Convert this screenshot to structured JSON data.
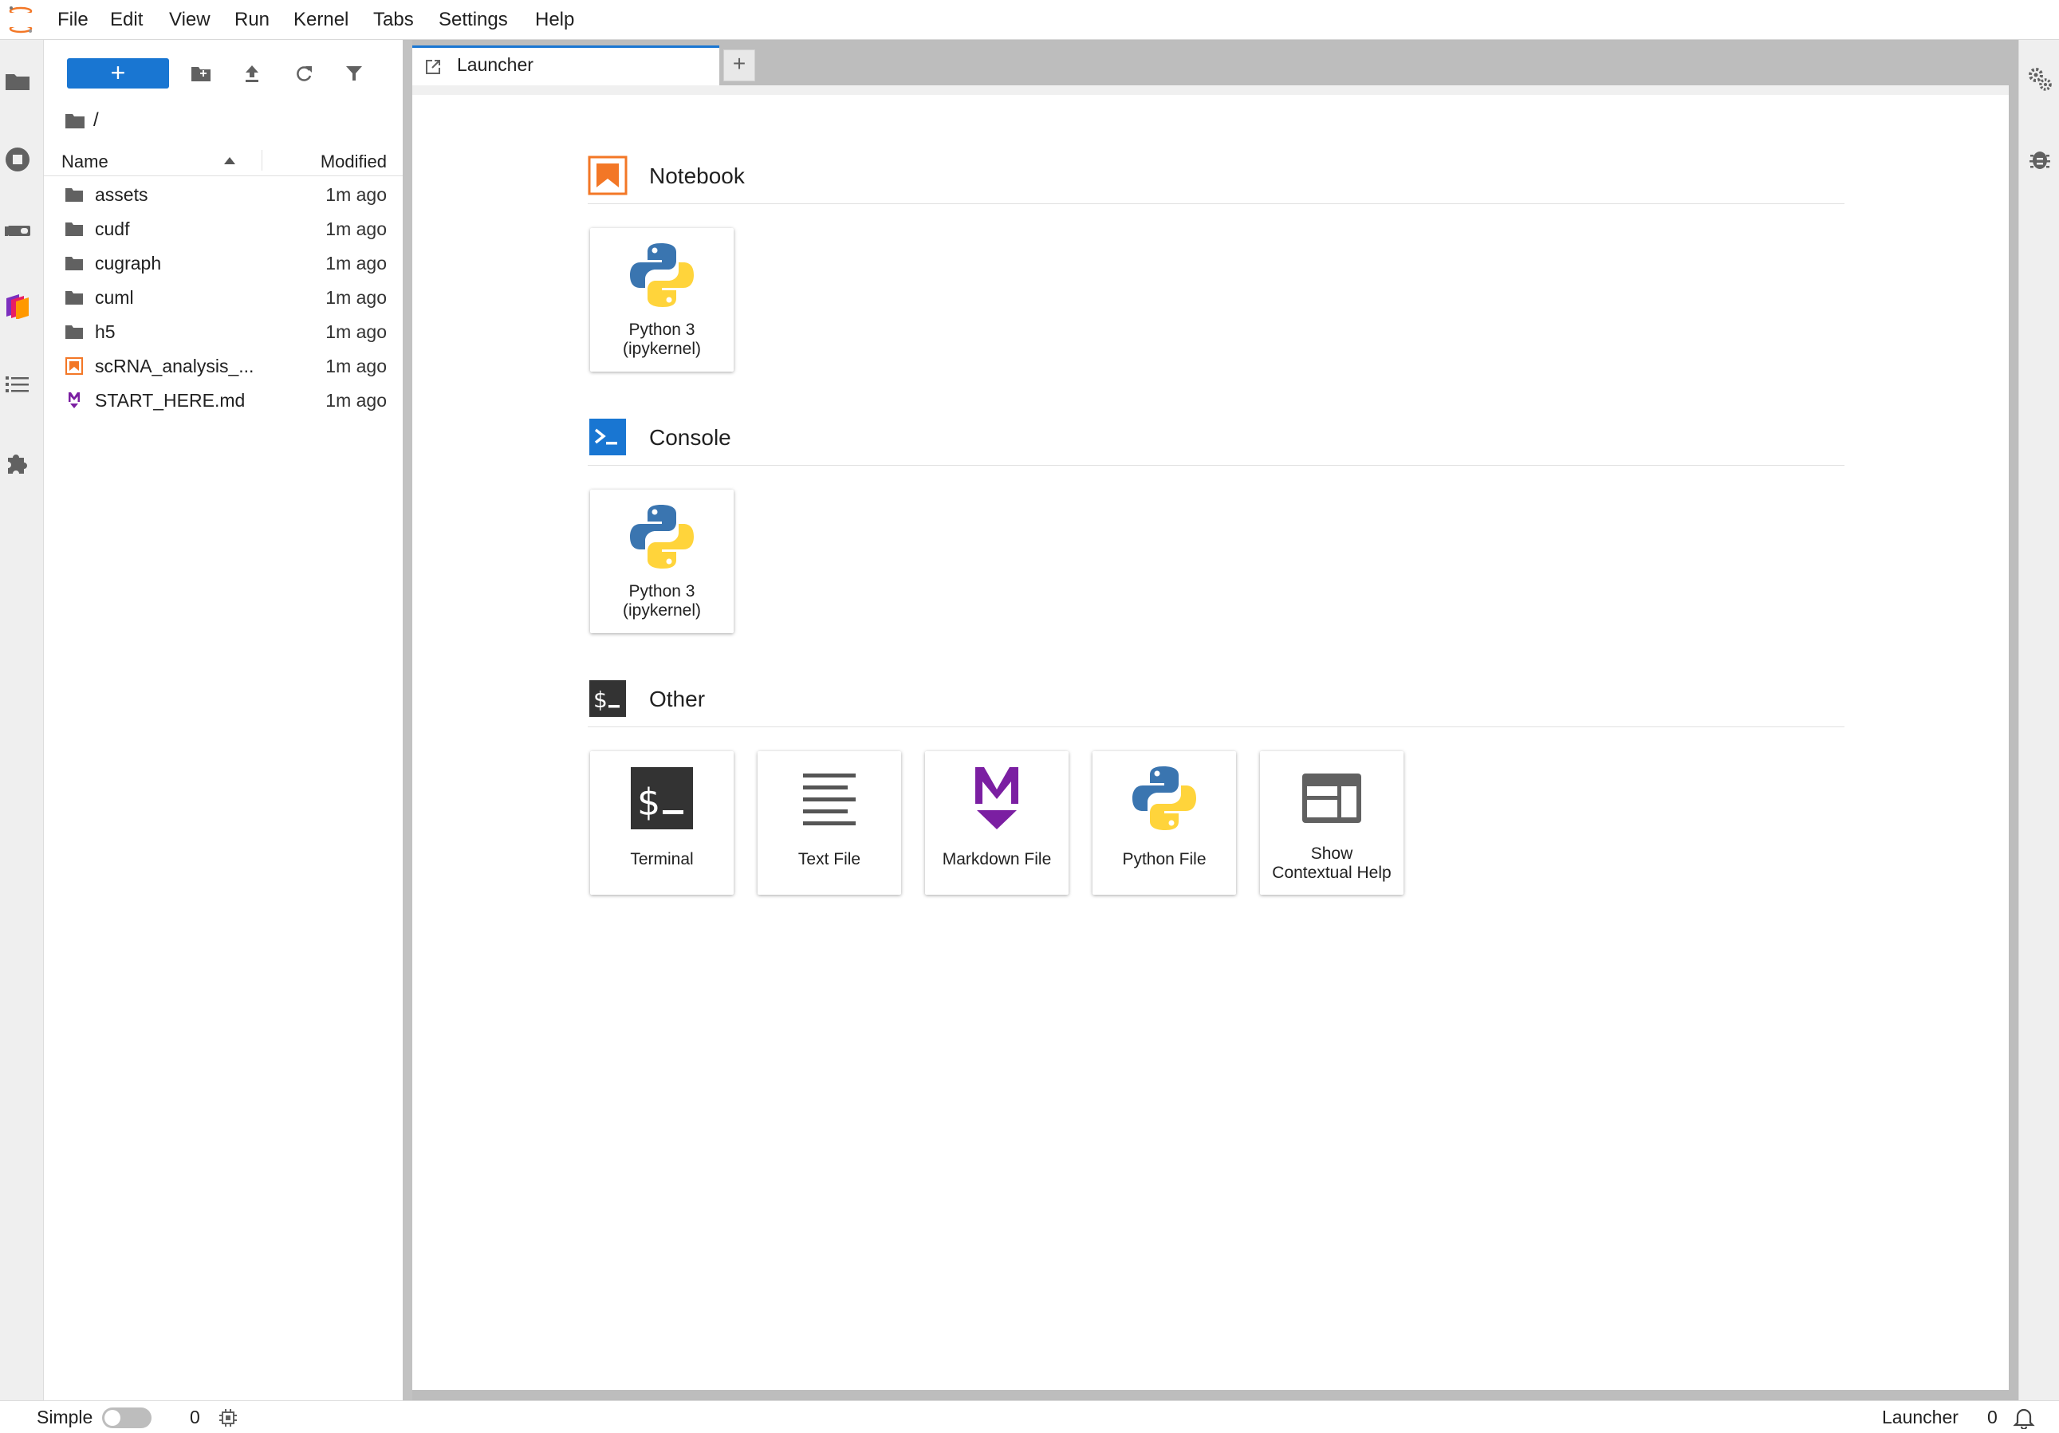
{
  "menubar": {
    "items": [
      "File",
      "Edit",
      "View",
      "Run",
      "Kernel",
      "Tabs",
      "Settings",
      "Help"
    ]
  },
  "activitybar": {
    "icons": [
      "folder-icon",
      "running-icon",
      "gpu-dashboard-icon",
      "extension-stack-icon",
      "table-of-contents-icon",
      "puzzle-icon"
    ]
  },
  "filebrowser": {
    "new_button": "+",
    "breadcrumb": "/",
    "columns": {
      "name": "Name",
      "modified": "Modified"
    },
    "rows": [
      {
        "name": "assets",
        "modified": "1m ago",
        "type": "folder"
      },
      {
        "name": "cudf",
        "modified": "1m ago",
        "type": "folder"
      },
      {
        "name": "cugraph",
        "modified": "1m ago",
        "type": "folder"
      },
      {
        "name": "cuml",
        "modified": "1m ago",
        "type": "folder"
      },
      {
        "name": "h5",
        "modified": "1m ago",
        "type": "folder"
      },
      {
        "name": "scRNA_analysis_...",
        "modified": "1m ago",
        "type": "notebook"
      },
      {
        "name": "START_HERE.md",
        "modified": "1m ago",
        "type": "markdown"
      }
    ]
  },
  "tabs": {
    "active": "Launcher",
    "add_label": "+"
  },
  "launcher": {
    "sections": [
      {
        "title": "Notebook",
        "cards": [
          {
            "label1": "Python 3",
            "label2": "(ipykernel)"
          }
        ]
      },
      {
        "title": "Console",
        "cards": [
          {
            "label1": "Python 3",
            "label2": "(ipykernel)"
          }
        ]
      },
      {
        "title": "Other",
        "cards": [
          {
            "label1": "Terminal",
            "label2": ""
          },
          {
            "label1": "Text File",
            "label2": ""
          },
          {
            "label1": "Markdown File",
            "label2": ""
          },
          {
            "label1": "Python File",
            "label2": ""
          },
          {
            "label1": "Show",
            "label2": "Contextual Help"
          }
        ]
      }
    ]
  },
  "statusbar": {
    "mode_label": "Simple",
    "kernels_count": "0",
    "active_label": "Launcher",
    "notifications_count": "0"
  },
  "colors": {
    "accent": "#1976d2",
    "notebook_orange": "#f37726",
    "markdown_purple": "#7b1fa2",
    "python_blue": "#3a75b0",
    "python_yellow": "#ffd43b"
  }
}
